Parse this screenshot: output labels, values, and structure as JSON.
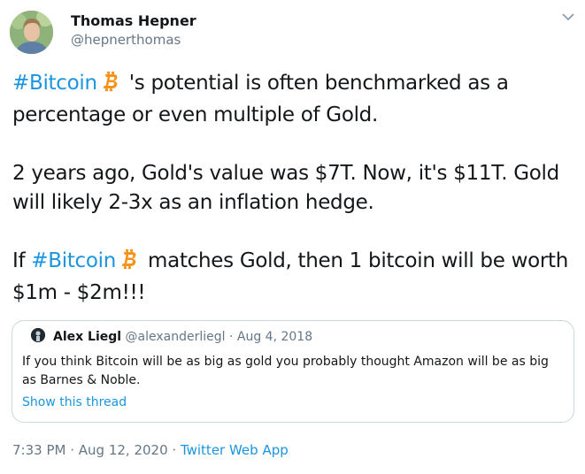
{
  "author": {
    "name": "Thomas Hepner",
    "handle": "@hepnerthomas"
  },
  "tweet": {
    "para1": {
      "hashtag": "#Bitcoin",
      "text": " 's potential is often benchmarked as a",
      "line2": "percentage or even multiple of Gold."
    },
    "para2": {
      "line1": "2 years ago, Gold's value was $7T. Now, it's $11T. Gold",
      "line2": "will likely 2-3x as an inflation hedge."
    },
    "para3": {
      "prefix": "If ",
      "hashtag": "#Bitcoin",
      "text": " matches Gold, then 1 bitcoin will be worth",
      "line2": "$1m - $2m!!!"
    }
  },
  "quoted_tweet": {
    "name": "Alex Liegl",
    "handle": "@alexanderliegl",
    "separator": " · ",
    "date": "Aug 4, 2018",
    "text": "If you think Bitcoin will be as big as gold you probably thought Amazon will be as big as Barnes & Noble.",
    "show_thread": "Show this thread"
  },
  "meta": {
    "time": "7:33 PM",
    "separator": " · ",
    "date": "Aug 12, 2020",
    "source": "Twitter Web App"
  },
  "colors": {
    "link": "#1b95e0",
    "bitcoin": "#f7931a",
    "secondary_text": "#657786"
  },
  "icons": {
    "menu": "chevron-down-icon",
    "hashtag_emoji": "bitcoin-icon"
  }
}
